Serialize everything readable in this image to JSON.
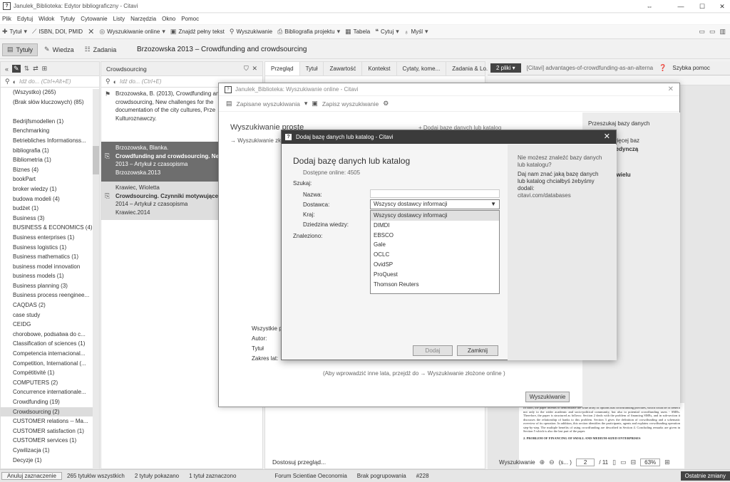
{
  "window": {
    "title": "Janulek_Biblioteka: Edytor bibliograficzny - Citavi",
    "controls": [
      "⇔",
      "—",
      "☐",
      "✕"
    ]
  },
  "menu": [
    "Plik",
    "Edytuj",
    "Widok",
    "Tytuły",
    "Cytowanie",
    "Listy",
    "Narzędzia",
    "Okno",
    "Pomoc"
  ],
  "toolbar": {
    "add_title": "Tytuł",
    "isbn": "ISBN, DOI, PMID",
    "online_search": "Wyszukiwanie online",
    "find_fulltext": "Znajdź pełny tekst",
    "search": "Wyszukiwanie",
    "project_bib": "Bibliografia projektu",
    "table": "Tabela",
    "cite": "Cytuj",
    "thought": "Myśl"
  },
  "perspectives": {
    "titles": "Tytuły",
    "knowledge": "Wiedza",
    "tasks": "Zadania"
  },
  "reference_heading": "Brzozowska 2013 – Crowdfunding and crowdsourcing",
  "left": {
    "header": "Crowdsourcing",
    "search_placeholder": "Idź do... (Ctrl+Alt+E)",
    "items": [
      "(Wszystko) (265)",
      "(Brak słów kluczowych) (85)",
      "",
      "Bedrijfsmodellen (1)",
      "Benchmarking",
      "Betriebliches Informationss...",
      "bibliografia (1)",
      "Bibliometria (1)",
      "Biznes (4)",
      "bookPart",
      "broker wiedzy (1)",
      "budowa modeli (4)",
      "budżet (1)",
      "Business (3)",
      "BUSINESS & ECONOMICS (4)",
      "Business enterprises (1)",
      "Business logistics (1)",
      "Business mathematics (1)",
      "business model innovation",
      "business models (1)",
      "Business planning (3)",
      "Business process reenginee...",
      "CAQDAS (2)",
      "case study",
      "CEIDG",
      "chorobowe, podsatwa do c...",
      "Classification of sciences (1)",
      "Competencia internacional...",
      "Competition, International (...",
      "Compétitivité (1)",
      "COMPUTERS (2)",
      "Concurrence internationale...",
      "Crowdfunding (19)",
      "Crowdsourcing (2)",
      "CUSTOMER relations -- Ma...",
      "CUSTOMER satisfaction (1)",
      "CUSTOMER services (1)",
      "Cywilizacja (1)",
      "Decyzje (1)"
    ],
    "selected_index": 33
  },
  "middle": {
    "search_placeholder": "Idź do... (Ctrl+E)",
    "ref1": {
      "l1": "Brzozowska, B. (2013), Crowdfunding an",
      "l2": "crowdsourcing, New challenges for the",
      "l3": "documentation of the city cultures, Prze",
      "l4": "Kulturoznawczy."
    },
    "ref2": {
      "author": "Brzozowska, Blanka.",
      "title": "Crowdfunding and crowdsourcing. Ne",
      "type": "2013 – Artykuł z czasopisma",
      "key": "Brzozowska.2013"
    },
    "ref3": {
      "author": "Krawiec, Wioletta",
      "title": "Crowdsourcing. Czynniki motywujące",
      "type": "2014 – Artykuł z czasopisma",
      "key": "Krawiec.2014"
    }
  },
  "detail": {
    "tabs": [
      "Przegląd",
      "Tytuł",
      "Zawartość",
      "Kontekst",
      "Cytaty, kome...",
      "Zadania & Lo..."
    ],
    "bottom": "Dostosuj przegląd..."
  },
  "pdf": {
    "files": "2 pliki",
    "doc_title": "[Citavi]  advantages-of-crowdfunding-as-an-alterna",
    "quick": "Szybka pomoc",
    "search": "Wyszukiwanie",
    "page_current": "2",
    "page_total": "/ 11",
    "zoom": "63%",
    "paragraph": "In short, the paper intends to demonstrate the wide array of options that crowdfunding provides, which could be of benefit not only to the wider academic and socio-political community, but also to potential crowdfunding users - SMEs. Therefore, the paper is structured as follows: Section 2 deals with the problem of financing SMEs, and in sub-section it discusses the relationship of banks to this problem. Section 3 gives the definition of crowdfunding and a schematic overview of its operation. In addition, this section identifies the participants, agents and explains crowdfunding operation step-by-step. The multiple benefits of using crowdfunding are described in Section 4. Concluding remarks are given in Section 5 which is also the last part of the paper.",
    "heading": "2. PROBLEM OF FINANCING OF SMALL AND MEDIUM-SIZED ENTERPRISES"
  },
  "status": {
    "cancel_sel": "Anuluj zaznaczenie",
    "total": "265 tytułów wszystkich",
    "shown": "2 tytuły pokazano",
    "selected": "1 tytuł zaznaczono",
    "journal": "Forum Scientiae Oeconomia",
    "grouping": "Brak pogrupowania",
    "id": "#228",
    "recent": "Ostatnie zmiany"
  },
  "online_window": {
    "title": "Janulek_Biblioteka: Wyszukiwanie online - Citavi",
    "saved": "Zapisane wyszukiwania",
    "save": "Zapisz wyszukiwanie",
    "simple": "Wyszukiwanie proste",
    "advanced_link": "Wyszukiwanie złożone",
    "add_db": "Dodaj bazę danych lub katalog",
    "right": {
      "head": "Przeszukaj bazy danych",
      "l1": "jedną lub więcej baz",
      "l2": "szukaj pojedynczą",
      "l3": "danych:",
      "l4": "olegle",
      "l5": "kiwanie w wielu",
      "l6": "s danych:"
    },
    "fields": {
      "all": "Wszystkie p",
      "author": "Autor:",
      "title": "Tytuł",
      "years": "Zakres lat:"
    },
    "hint": "(Aby wprowadzić inne lata, przejdź do",
    "hint_link": "Wyszukiwanie złożone online )",
    "search_btn": "Wyszukiwanie"
  },
  "dialog": {
    "title": "Dodaj bazę danych lub katalog - Citavi",
    "heading": "Dodaj bazę danych lub katalog",
    "available": "Dostępne online: 4505",
    "search_label": "Szukaj:",
    "name": "Nazwa:",
    "provider": "Dostawca:",
    "country": "Kraj:",
    "field": "Dziedzina wiedzy:",
    "found": "Znaleziono:",
    "provider_value": "Wszyscy dostawcy informacji",
    "options": [
      "Wszyscy dostawcy informacji",
      "DIMDI",
      "EBSCO",
      "Gale",
      "OCLC",
      "OvidSP",
      "ProQuest",
      "Thomson Reuters"
    ],
    "side_q": "Nie możesz znaleźć bazy danych lub katalogu?",
    "side_text": "Daj nam znać jaką bazę danych lub katalog chciałbyś żebyśmy dodali:",
    "side_link": "citavi.com/databases",
    "add_btn": "Dodaj",
    "close_btn": "Zamknij"
  }
}
